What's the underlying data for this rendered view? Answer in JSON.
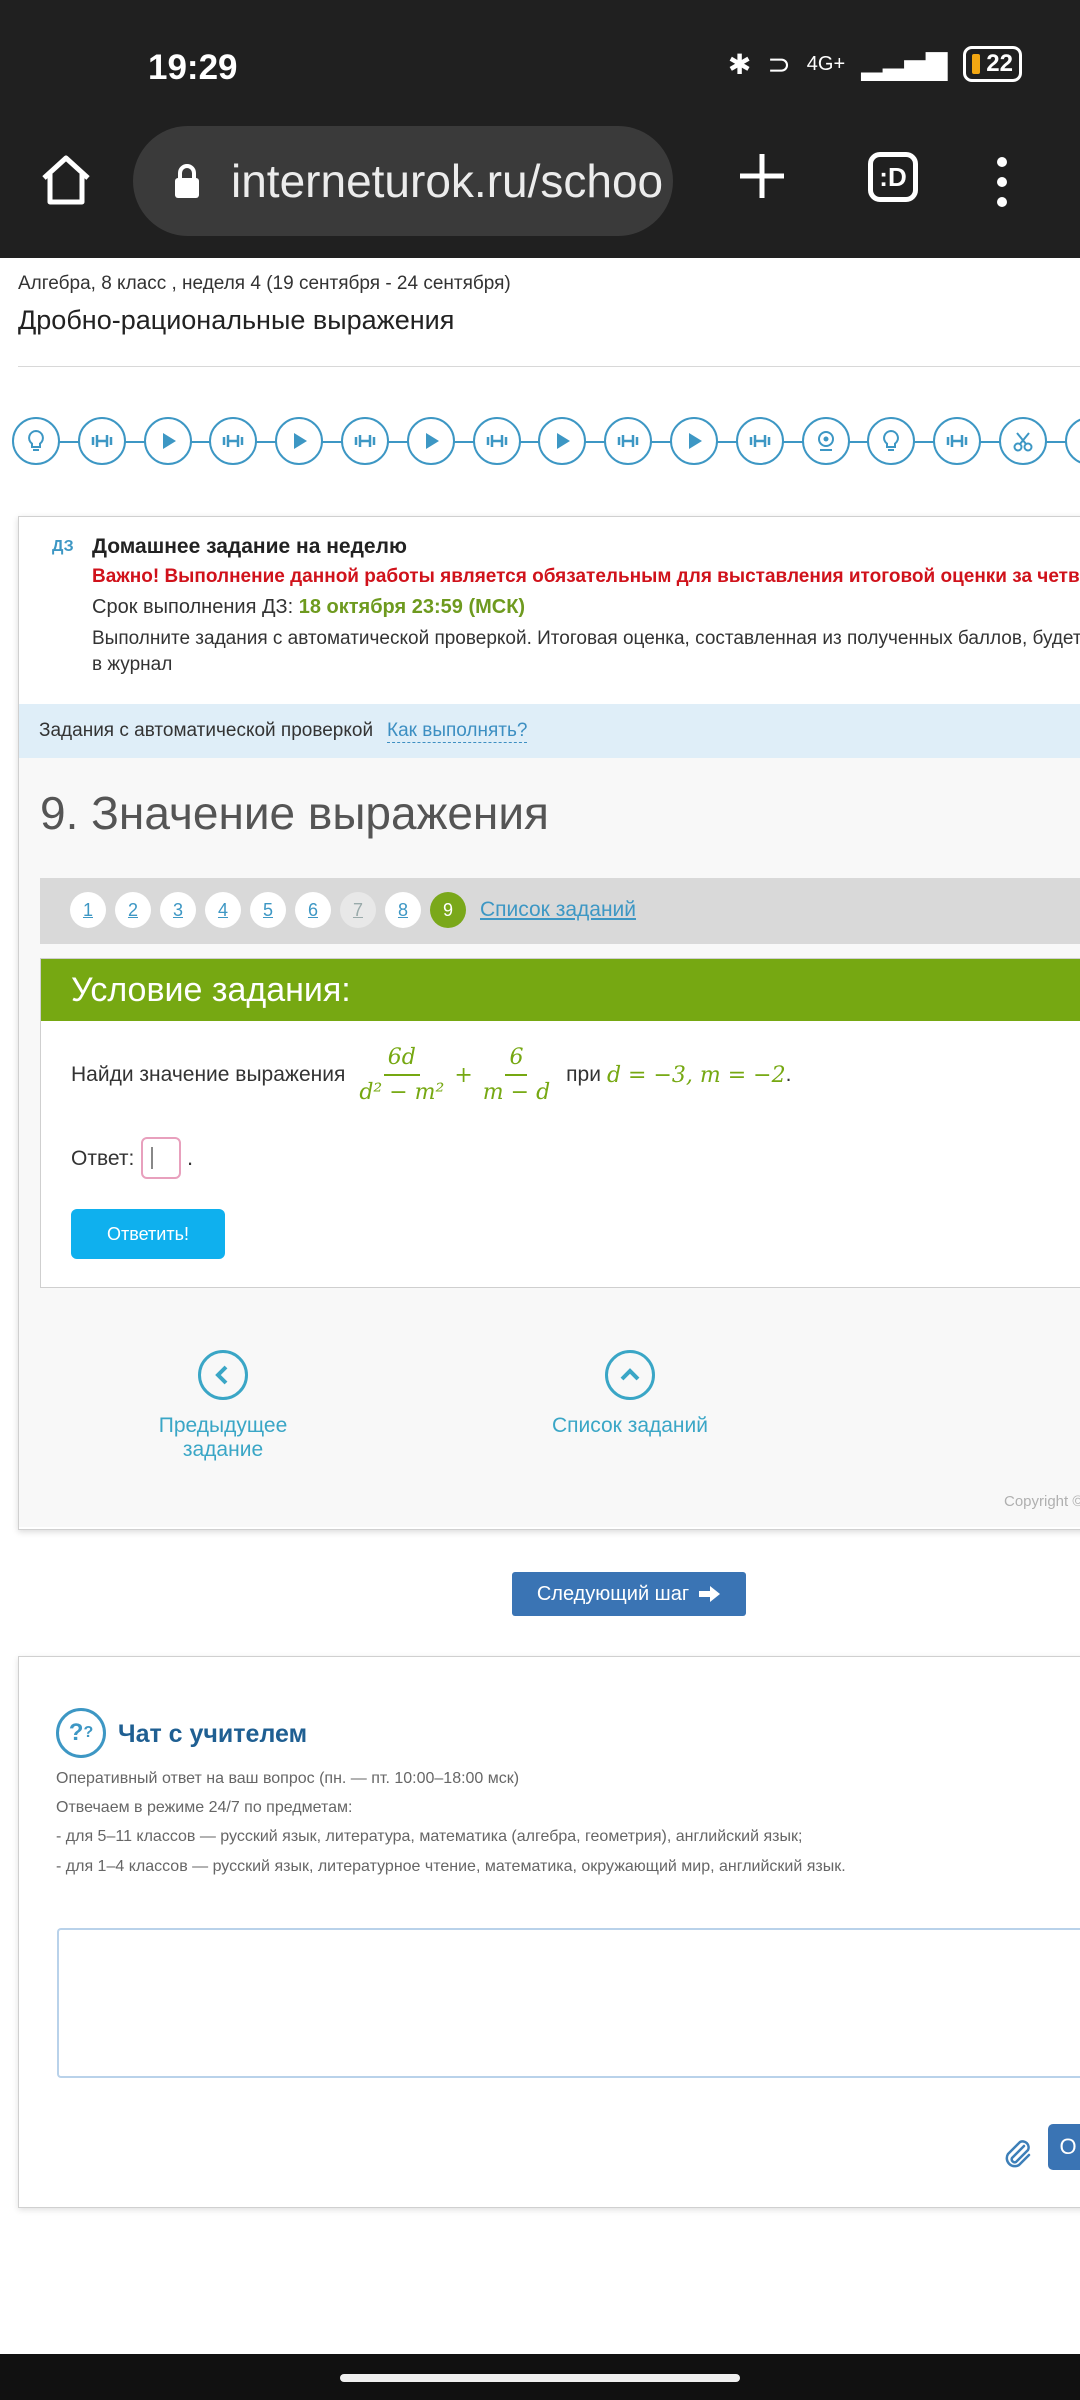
{
  "status": {
    "time": "19:29",
    "network": "4G+",
    "battery": "22"
  },
  "browser": {
    "url": "interneturok.ru/schoo",
    "tabs_label": ":D"
  },
  "page": {
    "breadcrumb": "Алгебра, 8 класс , неделя 4 (19 сентября - 24 сентября)",
    "title": "Дробно-рациональные выражения"
  },
  "steps": [
    "lightbulb-icon",
    "dumbbell-icon",
    "play-icon",
    "dumbbell-icon",
    "play-icon",
    "dumbbell-icon",
    "play-icon",
    "dumbbell-icon",
    "play-icon",
    "dumbbell-icon",
    "play-icon",
    "dumbbell-icon",
    "webcam-icon",
    "lightbulb-icon",
    "dumbbell-icon",
    "scissors-icon"
  ],
  "homework": {
    "tag": "ДЗ",
    "title": "Домашнее задание на неделю",
    "important": "Важно! Выполнение данной работы является обязательным для выставления итоговой оценки за четверть.",
    "deadline_label": "Срок выполнения ДЗ: ",
    "deadline_value": "18 октября 23:59 (МСК)",
    "description": "Выполните задания с автоматической проверкой. Итоговая оценка, составленная из полученных баллов, будет вы",
    "description_cont": "в журнал"
  },
  "auto_check": {
    "label": "Задания с автоматической проверкой",
    "how_link": "Как выполнять?"
  },
  "task": {
    "heading": "9. Значение выражения",
    "numbers": [
      "1",
      "2",
      "3",
      "4",
      "5",
      "6",
      "7",
      "8",
      "9"
    ],
    "list_link": "Список заданий",
    "condition_header": "Условие задания:",
    "prompt": "Найди значение выражения",
    "frac1_num": "6d",
    "frac1_den": "d² − m²",
    "plus": "+",
    "frac2_num": "6",
    "frac2_den": "m − d",
    "at": "при",
    "values": "d = −3, m = −2",
    "answer_label": "Ответ:",
    "answer_value": "",
    "submit": "Ответить!"
  },
  "navigation": {
    "prev": "Предыдущее задание",
    "list": "Список заданий",
    "copyright": "Copyright ©",
    "next_step": "Следующий шаг"
  },
  "chat": {
    "title": "Чат с учителем",
    "line1": "Оперативный ответ на ваш вопрос (пн. — пт. 10:00–18:00 мск)",
    "line2": "Отвечаем в режиме 24/7 по предметам:",
    "line3": "- для 5–11 классов — русский язык, литература, математика (алгебра, геометрия), английский язык;",
    "line4": "- для 1–4 классов — русский язык, литературное чтение, математика, окружающий мир, английский язык.",
    "send_label": "О"
  },
  "colors": {
    "accent_green": "#76a812",
    "link_blue": "#3d97c4",
    "button_blue": "#0fb0ee",
    "alert_red": "#d0121b"
  }
}
